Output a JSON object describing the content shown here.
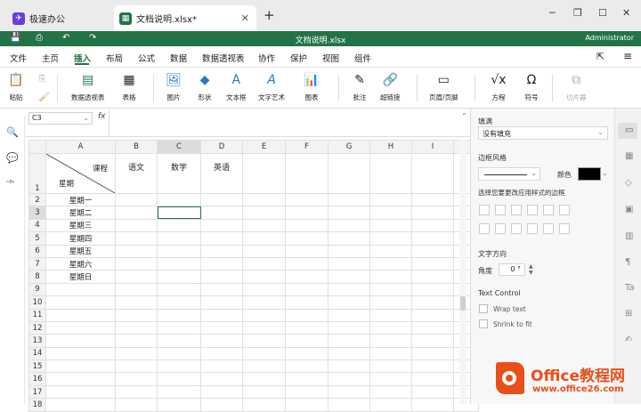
{
  "tabs": [
    {
      "label": "极速办公",
      "icon": "app-logo-icon"
    },
    {
      "label": "文档说明.xlsx*",
      "icon": "spreadsheet-icon"
    }
  ],
  "window": {
    "doc_title": "文档说明.xlsx",
    "user": "Administrator"
  },
  "menu": [
    "文件",
    "主页",
    "插入",
    "布局",
    "公式",
    "数据",
    "数据透视表",
    "协作",
    "保护",
    "视图",
    "组件"
  ],
  "ribbon": {
    "paste": "粘贴",
    "pivot": "数据透视表",
    "table": "表格",
    "image": "图片",
    "shape": "形状",
    "textbox": "文本框",
    "wordart": "文字艺术",
    "chart": "图表",
    "comment": "批注",
    "hyperlink": "超链接",
    "header_footer": "页眉/页脚",
    "equation": "方程",
    "symbol": "符号",
    "slicer": "切片器"
  },
  "formula": {
    "name_box": "C3",
    "fx": "fx",
    "value": ""
  },
  "sheet": {
    "columns": [
      "A",
      "B",
      "C",
      "D",
      "E",
      "F",
      "G",
      "H",
      "I"
    ],
    "rows": [
      "1",
      "2",
      "3",
      "4",
      "5",
      "6",
      "7",
      "8",
      "9",
      "10",
      "11",
      "12",
      "13",
      "14",
      "15",
      "16",
      "17",
      "18"
    ],
    "header_course": "课程",
    "header_week": "星期",
    "subjects": [
      "语文",
      "数学",
      "英语"
    ],
    "weekdays": [
      "星期一",
      "星期二",
      "星期三",
      "星期四",
      "星期五",
      "星期六",
      "星期日"
    ],
    "selected_cell": "C3"
  },
  "panel": {
    "fill_title": "填满",
    "fill_value": "没有填充",
    "border_title": "边框风格",
    "color_label": "颜色",
    "border_hint": "选择您要更改应用样式的边框",
    "text_dir_title": "文字方向",
    "angle_label": "角度",
    "angle_value": "0 °",
    "text_control_title": "Text Control",
    "wrap_text": "Wrap text",
    "shrink_to_fit": "Shrink to fit"
  },
  "watermark": {
    "brand": "Office教程网",
    "url": "www.office26.com"
  },
  "colors": {
    "accent": "#227447",
    "brand_orange": "#e8501a"
  }
}
